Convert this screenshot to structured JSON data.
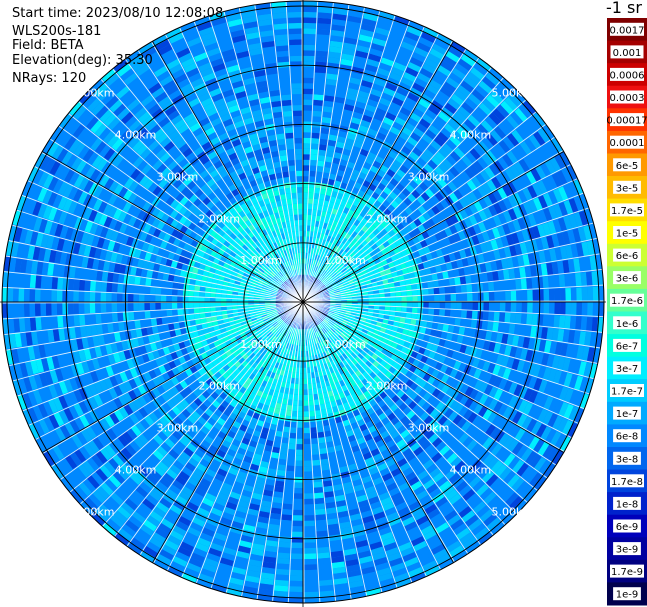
{
  "info": {
    "start_time": "Start time: 2023/08/10 12:08:08",
    "instrument": "WLS200s-181",
    "field": "Field: BETA",
    "elevation": "Elevation(deg): 35.30",
    "nrays": "NRays: 120"
  },
  "colorbar": {
    "title": "-1 sr",
    "labels": [
      "0.0017",
      "0.001",
      "0.0006",
      "0.0003",
      "0.00017",
      "0.0001",
      "6e-5",
      "3e-5",
      "1.7e-5",
      "1e-5",
      "6e-6",
      "3e-6",
      "1.7e-6",
      "1e-6",
      "6e-7",
      "3e-7",
      "1.7e-7",
      "1e-7",
      "6e-8",
      "3e-8",
      "1.7e-8",
      "1e-8",
      "6e-9",
      "3e-9",
      "1.7e-9",
      "1e-9"
    ],
    "colors": [
      "#7f0000",
      "#a50000",
      "#cc0000",
      "#ee1010",
      "#ff3300",
      "#ff6600",
      "#ff9900",
      "#ffbb00",
      "#ffdd00",
      "#ffff00",
      "#ccff33",
      "#99ff66",
      "#66ff99",
      "#33ffcc",
      "#00ffe0",
      "#00eeff",
      "#00ccff",
      "#00aaff",
      "#0088ff",
      "#0066ee",
      "#0044dd",
      "#0022cc",
      "#0000bb",
      "#0000a0",
      "#000080",
      "#00004d"
    ]
  },
  "chart_data": {
    "type": "heatmap",
    "projection": "polar (PPI scan)",
    "field": "BETA",
    "units": "-1 sr",
    "n_rays": 120,
    "elevation_deg": 35.3,
    "range_ring_labels": [
      "1.00km",
      "2.00km",
      "3.00km",
      "4.00km",
      "5.00km"
    ],
    "range_rings_km": [
      1,
      2,
      3,
      4,
      5
    ],
    "max_range_km": 6.2,
    "color_scale": "log",
    "value_range": [
      1e-09,
      0.0017
    ],
    "dominant_values": {
      "near_range_0.5_2km": "3e-7 to 1e-6",
      "mid_far_range_2_6km": "3e-8 to 1.7e-7"
    }
  }
}
